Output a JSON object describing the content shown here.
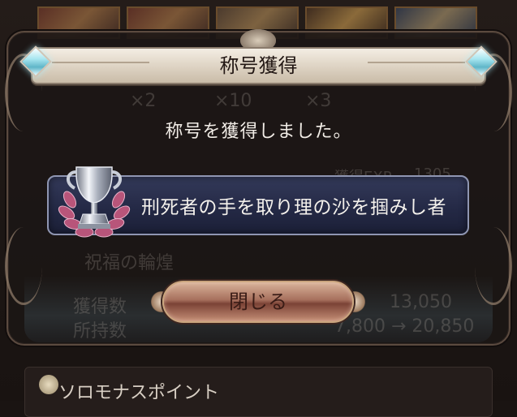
{
  "dialog": {
    "title": "称号獲得",
    "message": "称号を獲得しました。",
    "earned_title": "刑死者の手を取り理の沙を掴みし者",
    "close_label": "閉じる"
  },
  "background": {
    "lower_label": "ソロモナスポイント",
    "section_label": "祝福の輪煌",
    "obtained_label": "獲得数",
    "held_label": "所持数",
    "obtained_value": "13,050",
    "held_value": "7,800 → 20,850",
    "exp_label": "獲得EXP",
    "exp_value": "1305",
    "counts": [
      "×2",
      "×10",
      "×3"
    ]
  },
  "icons": {
    "trophy": "trophy-icon",
    "gem": "diamond-gem-icon"
  },
  "colors": {
    "plate": "#232844",
    "banner": "#e8dfd2",
    "button": "#a7705d"
  }
}
